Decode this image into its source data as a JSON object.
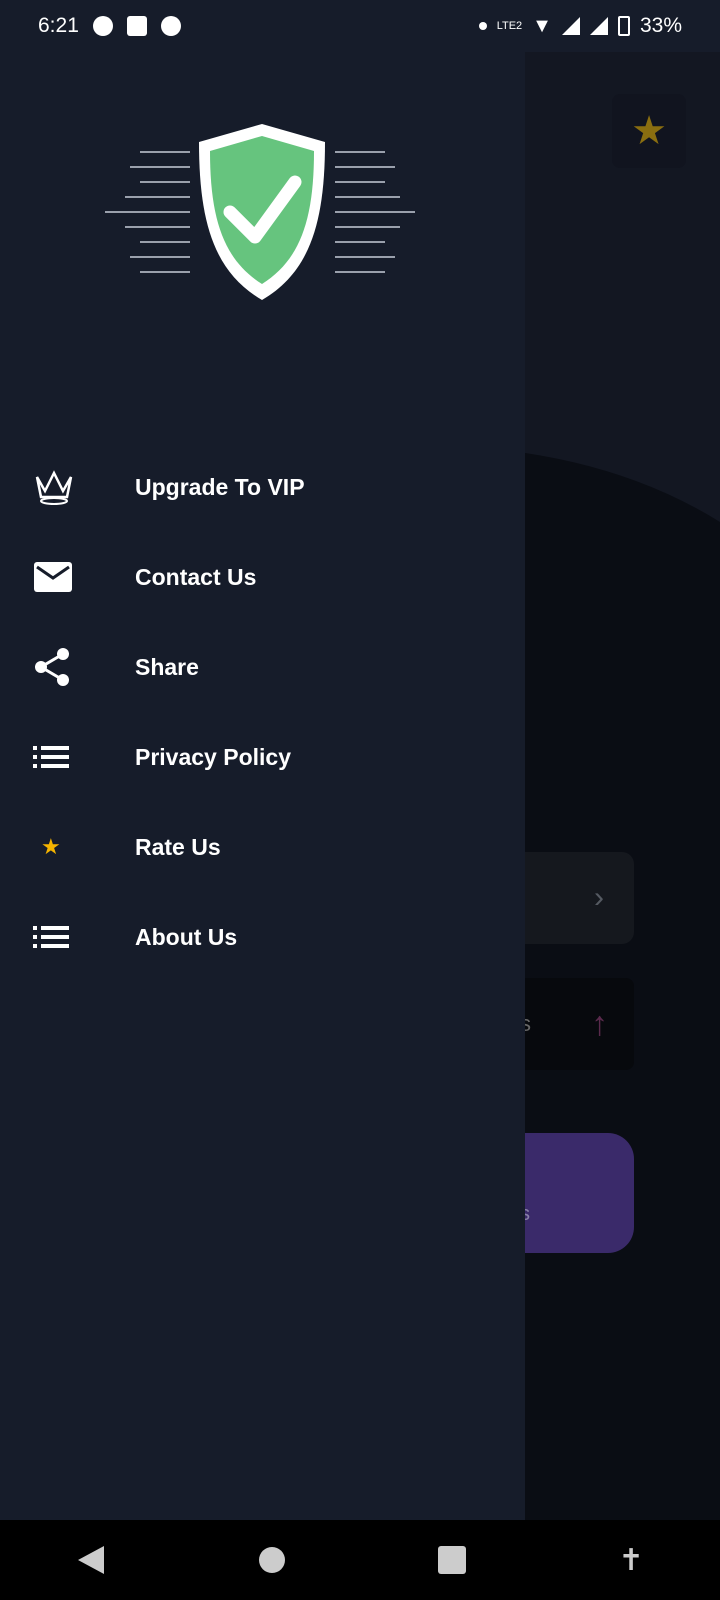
{
  "status_bar": {
    "time": "6:21",
    "network": "LTE2",
    "battery": "33%"
  },
  "drawer": {
    "items": [
      {
        "label": "Upgrade To VIP",
        "icon": "crown-icon"
      },
      {
        "label": "Contact Us",
        "icon": "mail-icon"
      },
      {
        "label": "Share",
        "icon": "share-icon"
      },
      {
        "label": "Privacy Policy",
        "icon": "list-icon"
      },
      {
        "label": "Rate Us",
        "icon": "star-icon"
      },
      {
        "label": "About Us",
        "icon": "list-icon"
      }
    ]
  },
  "background": {
    "card2_partial": "s",
    "card3_partial": "s"
  },
  "colors": {
    "drawer": "#161c2a",
    "shield": "#66c47e",
    "star": "#f5b400",
    "accent_purple": "#3a2a6a"
  }
}
